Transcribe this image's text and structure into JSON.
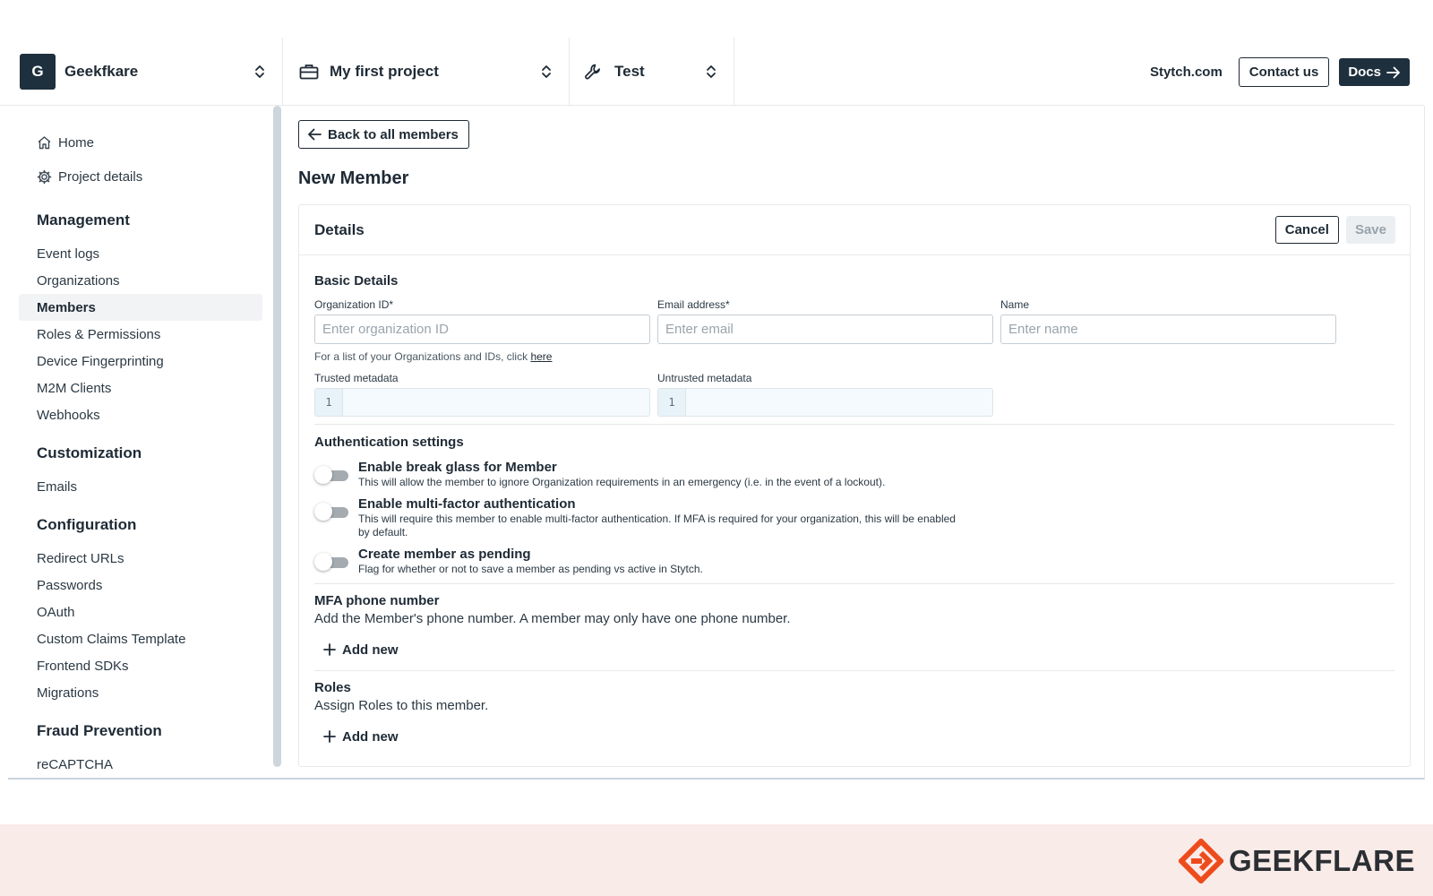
{
  "topbar": {
    "org": {
      "avatar": "G",
      "name": "Geekfkare"
    },
    "project": {
      "name": "My first project",
      "icon": "briefcase-icon"
    },
    "environment": {
      "name": "Test",
      "icon": "wrench-icon"
    },
    "links": {
      "site": "Stytch.com",
      "contact": "Contact us",
      "docs": "Docs"
    }
  },
  "sidebar": {
    "top": [
      {
        "label": "Home",
        "icon": "home-icon"
      },
      {
        "label": "Project details",
        "icon": "gear-icon"
      }
    ],
    "sections": [
      {
        "title": "Management",
        "items": [
          "Event logs",
          "Organizations",
          "Members",
          "Roles & Permissions",
          "Device Fingerprinting",
          "M2M Clients",
          "Webhooks"
        ]
      },
      {
        "title": "Customization",
        "items": [
          "Emails"
        ]
      },
      {
        "title": "Configuration",
        "items": [
          "Redirect URLs",
          "Passwords",
          "OAuth",
          "Custom Claims Template",
          "Frontend SDKs",
          "Migrations"
        ]
      },
      {
        "title": "Fraud Prevention",
        "items": [
          "reCAPTCHA"
        ]
      }
    ],
    "active": "Members"
  },
  "main": {
    "back_label": "Back to all members",
    "title": "New Member",
    "card": {
      "title": "Details",
      "cancel": "Cancel",
      "save": "Save",
      "basic": {
        "title": "Basic Details",
        "org_label": "Organization ID*",
        "org_placeholder": "Enter organization ID",
        "email_label": "Email address*",
        "email_placeholder": "Enter email",
        "name_label": "Name",
        "name_placeholder": "Enter name",
        "hint_prefix": "For a list of your Organizations and IDs, click ",
        "hint_link": "here",
        "trusted_label": "Trusted metadata",
        "untrusted_label": "Untrusted metadata",
        "line_no": "1"
      },
      "auth": {
        "title": "Authentication settings",
        "toggles": [
          {
            "title": "Enable break glass for Member",
            "desc": "This will allow the member to ignore Organization requirements in an emergency (i.e. in the event of a lockout).",
            "on": false
          },
          {
            "title": "Enable multi-factor authentication",
            "desc": "This will require this member to enable multi-factor authentication. If MFA is required for your organization, this will be enabled by default.",
            "on": false
          },
          {
            "title": "Create member as pending",
            "desc": "Flag for whether or not to save a member as pending vs active in Stytch.",
            "on": false
          }
        ]
      },
      "mfa": {
        "title": "MFA phone number",
        "desc": "Add the Member's phone number. A member may only have one phone number.",
        "add": "Add new"
      },
      "roles": {
        "title": "Roles",
        "desc": "Assign Roles to this member.",
        "add": "Add new"
      }
    }
  },
  "footer": {
    "brand": "GEEKFLARE",
    "accent": "#ee4b1d"
  }
}
